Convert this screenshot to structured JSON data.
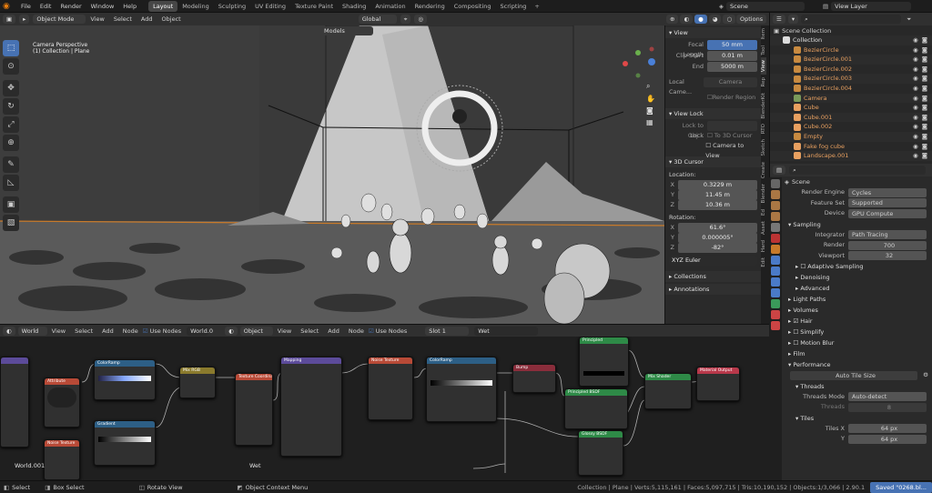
{
  "menus": [
    "File",
    "Edit",
    "Render",
    "Window",
    "Help"
  ],
  "workspaces": [
    "Layout",
    "Modeling",
    "Sculpting",
    "UV Editing",
    "Texture Paint",
    "Shading",
    "Animation",
    "Rendering",
    "Compositing",
    "Scripting"
  ],
  "active_workspace": "Layout",
  "scene_name": "Scene",
  "view_layer": "View Layer",
  "viewport": {
    "mode": "Object Mode",
    "menu": [
      "View",
      "Select",
      "Add",
      "Object"
    ],
    "orientation": "Global",
    "models_label": "Models",
    "options_label": "Options",
    "info_line1": "Camera Perspective",
    "info_line2": "(1) Collection | Plane"
  },
  "npanel": {
    "view_title": "View",
    "focal_label": "Focal Length",
    "focal_val": "50 mm",
    "clip_start_label": "Clip Start",
    "clip_start_val": "0.01 m",
    "end_label": "End",
    "end_val": "5000 m",
    "local_camera_label": "Local Came...",
    "camera_label": "Camera",
    "render_region": "Render Region",
    "view_lock_title": "View Lock",
    "lock_obj_label": "Lock to Obj...",
    "lock_label": "Lock",
    "to_3d_cursor": "To 3D Cursor",
    "camera_to_view": "Camera to View",
    "cursor_title": "3D Cursor",
    "location_label": "Location:",
    "loc": [
      {
        "axis": "X",
        "val": "0.3229 m"
      },
      {
        "axis": "Y",
        "val": "11.45 m"
      },
      {
        "axis": "Z",
        "val": "10.36 m"
      }
    ],
    "rotation_label": "Rotation:",
    "rot": [
      {
        "axis": "X",
        "val": "61.6°"
      },
      {
        "axis": "Y",
        "val": "0.000005°"
      },
      {
        "axis": "Z",
        "val": "-82°"
      }
    ],
    "rot_mode": "XYZ Euler",
    "collections": "Collections",
    "annotations": "Annotations",
    "tabs": [
      "Item",
      "Tool",
      "View",
      "Rep",
      "BlenderKit",
      "RTO",
      "Sketch",
      "Create",
      "Blender",
      "Ed",
      "Asset",
      "Hard",
      "Edit"
    ]
  },
  "outliner": {
    "title": "Scene Collection",
    "items": [
      {
        "name": "Collection",
        "color": "#e0e0e0",
        "icon": "collection"
      },
      {
        "name": "BezierCircle",
        "color": "#e8a060",
        "icon": "curve"
      },
      {
        "name": "BezierCircle.001",
        "color": "#e8a060",
        "icon": "curve"
      },
      {
        "name": "BezierCircle.002",
        "color": "#e8a060",
        "icon": "curve"
      },
      {
        "name": "BezierCircle.003",
        "color": "#e8a060",
        "icon": "curve"
      },
      {
        "name": "BezierCircle.004",
        "color": "#e8a060",
        "icon": "curve"
      },
      {
        "name": "Camera",
        "color": "#e8a060",
        "icon": "camera"
      },
      {
        "name": "Cube",
        "color": "#e8a060",
        "icon": "mesh"
      },
      {
        "name": "Cube.001",
        "color": "#e8a060",
        "icon": "mesh"
      },
      {
        "name": "Cube.002",
        "color": "#e8a060",
        "icon": "mesh"
      },
      {
        "name": "Empty",
        "color": "#e8a060",
        "icon": "empty"
      },
      {
        "name": "Fake fog cube",
        "color": "#e8a060",
        "icon": "mesh"
      },
      {
        "name": "Landscape.001",
        "color": "#e8a060",
        "icon": "mesh"
      }
    ]
  },
  "properties": {
    "scene_label": "Scene",
    "render_engine_label": "Render Engine",
    "render_engine": "Cycles",
    "feature_set_label": "Feature Set",
    "feature_set": "Supported",
    "device_label": "Device",
    "device": "GPU Compute",
    "sampling": "Sampling",
    "integrator_label": "Integrator",
    "integrator": "Path Tracing",
    "render_label": "Render",
    "render_samples": "700",
    "viewport_label": "Viewport",
    "viewport_samples": "32",
    "adaptive": "Adaptive Sampling",
    "denoising": "Denoising",
    "advanced": "Advanced",
    "light_paths": "Light Paths",
    "volumes": "Volumes",
    "hair": "Hair",
    "simplify": "Simplify",
    "motion_blur": "Motion Blur",
    "film": "Film",
    "performance": "Performance",
    "auto_tile": "Auto Tile Size",
    "threads": "Threads",
    "threads_mode_label": "Threads Mode",
    "threads_mode": "Auto-detect",
    "threads_label": "Threads",
    "threads_val": "8",
    "tiles": "Tiles",
    "tiles_x_label": "Tiles X",
    "tiles_x": "64 px",
    "tiles_y_label": "Y",
    "tiles_y": "64 px"
  },
  "node_editor": {
    "type": "World",
    "menu": [
      "View",
      "Select",
      "Add",
      "Node"
    ],
    "use_nodes": "Use Nodes",
    "world_name": "World.0",
    "object_label": "Object",
    "menu2": [
      "View",
      "Select",
      "Add",
      "Node"
    ],
    "use_nodes2": "Use Nodes",
    "slot": "Slot 1",
    "material": "Wet",
    "left_label": "World.001",
    "right_label": "Wet"
  },
  "nodes": [
    {
      "title": "Attribute",
      "color": "#b84a37"
    },
    {
      "title": "ColorRamp",
      "color": "#2d5f86"
    },
    {
      "title": "Gradient",
      "color": "#2d5f86"
    },
    {
      "title": "Mix RGB",
      "color": "#8a7a2d"
    },
    {
      "title": "Noise Texture",
      "color": "#b84a37"
    },
    {
      "title": "Texture Coordinate",
      "color": "#b84a37"
    },
    {
      "title": "Mapping",
      "color": "#5c4b9a"
    },
    {
      "title": "Noise Texture",
      "color": "#b84a37"
    },
    {
      "title": "ColorRamp",
      "color": "#2d5f86"
    },
    {
      "title": "Bump",
      "color": "#8a2d3b"
    },
    {
      "title": "Principled BSDF",
      "color": "#2e8a47"
    },
    {
      "title": "Glossy BSDF",
      "color": "#2e8a47"
    },
    {
      "title": "Mix Shader",
      "color": "#2e8a47"
    },
    {
      "title": "Material Output",
      "color": "#b8384a"
    },
    {
      "title": "Principled",
      "color": "#2e8a47"
    }
  ],
  "status": {
    "select": "Select",
    "box_select": "Box Select",
    "rotate_view": "Rotate View",
    "context_menu": "Object Context Menu",
    "stats": "Collection | Plane | Verts:5,115,161 | Faces:5,097,715 | Tris:10,190,152 | Objects:1/3,066 | 2.90.1",
    "saved": "Saved \"0268.bl..."
  }
}
